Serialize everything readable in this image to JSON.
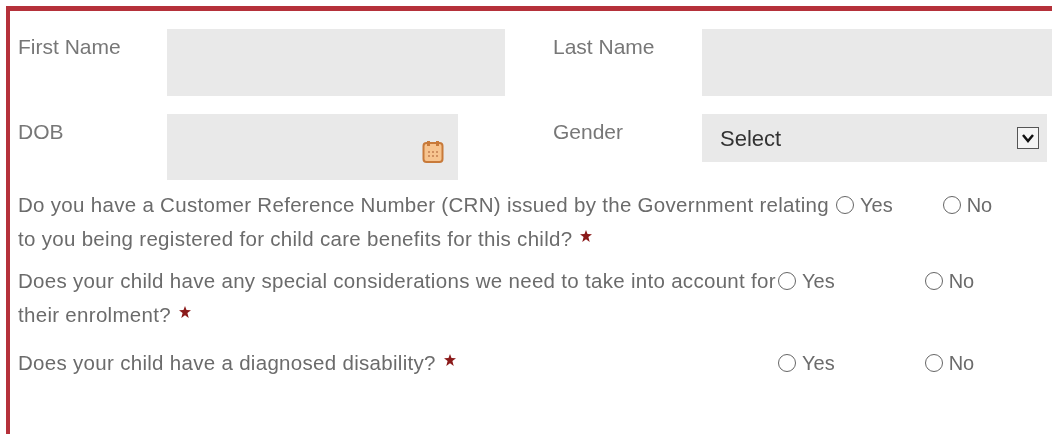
{
  "fields": [
    {
      "label": "First Name",
      "kind": "text"
    },
    {
      "label": "Last Name",
      "kind": "text"
    },
    {
      "label": "DOB",
      "kind": "date"
    },
    {
      "label": "Gender",
      "kind": "select",
      "value": "Select"
    }
  ],
  "questions": [
    {
      "text": "Do you have a Customer Reference Number (CRN) issued by the Government relating to you being registered for child care benefits for this child?",
      "required": true,
      "options": [
        {
          "label": "Yes",
          "selected": false
        },
        {
          "label": "No",
          "selected": false
        }
      ]
    },
    {
      "text": "Does your child have any special considerations we need to take into account for their enrolment?",
      "required": true,
      "options": [
        {
          "label": "Yes",
          "selected": false
        },
        {
          "label": "No",
          "selected": false
        }
      ]
    },
    {
      "text": "Does your child have a diagnosed disability?",
      "required": true,
      "options": [
        {
          "label": "Yes",
          "selected": false
        },
        {
          "label": "No",
          "selected": false
        }
      ]
    }
  ]
}
